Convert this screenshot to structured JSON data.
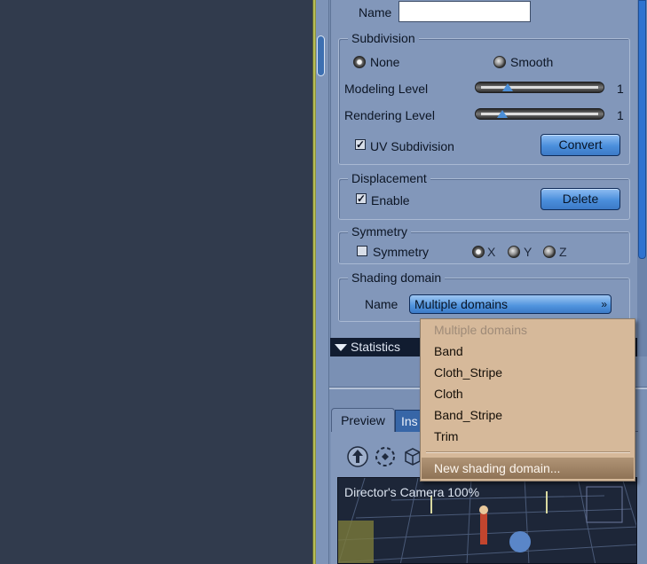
{
  "viewport_bg": "#313b4d",
  "surface": {
    "name_label": "Name",
    "name_value": "",
    "subdivision": {
      "title": "Subdivision",
      "none_label": "None",
      "smooth_label": "Smooth",
      "selected": "None",
      "modeling_label": "Modeling Level",
      "modeling_value": "1",
      "rendering_label": "Rendering Level",
      "rendering_value": "1",
      "uv_label": "UV Subdivision",
      "uv_checked": true,
      "convert_label": "Convert"
    },
    "displacement": {
      "title": "Displacement",
      "enable_label": "Enable",
      "enable_checked": true,
      "delete_label": "Delete"
    },
    "symmetry": {
      "title": "Symmetry",
      "symmetry_label": "Symmetry",
      "symmetry_checked": false,
      "x_label": "X",
      "y_label": "Y",
      "z_label": "Z"
    },
    "shading": {
      "title": "Shading domain",
      "name_label": "Name",
      "selected": "Multiple domains"
    },
    "statistics_label": "Statistics"
  },
  "tabs": {
    "preview": "Preview",
    "inspector": "Ins"
  },
  "camera_label": "Director's Camera 100%",
  "dropdown": {
    "items": [
      {
        "label": "Multiple domains",
        "disabled": true
      },
      {
        "label": "Band",
        "disabled": false
      },
      {
        "label": "Cloth_Stripe",
        "disabled": false
      },
      {
        "label": "Cloth",
        "disabled": false
      },
      {
        "label": "Band_Stripe",
        "disabled": false
      },
      {
        "label": "Trim",
        "disabled": false
      }
    ],
    "new_item": "New shading domain..."
  },
  "colors": {
    "panel": "#8297ba",
    "accent_button": "#4b8fdc",
    "menu_bg": "#d6b99a",
    "menu_highlight": "#9a7e61",
    "border_yellow": "#b6bd52"
  }
}
